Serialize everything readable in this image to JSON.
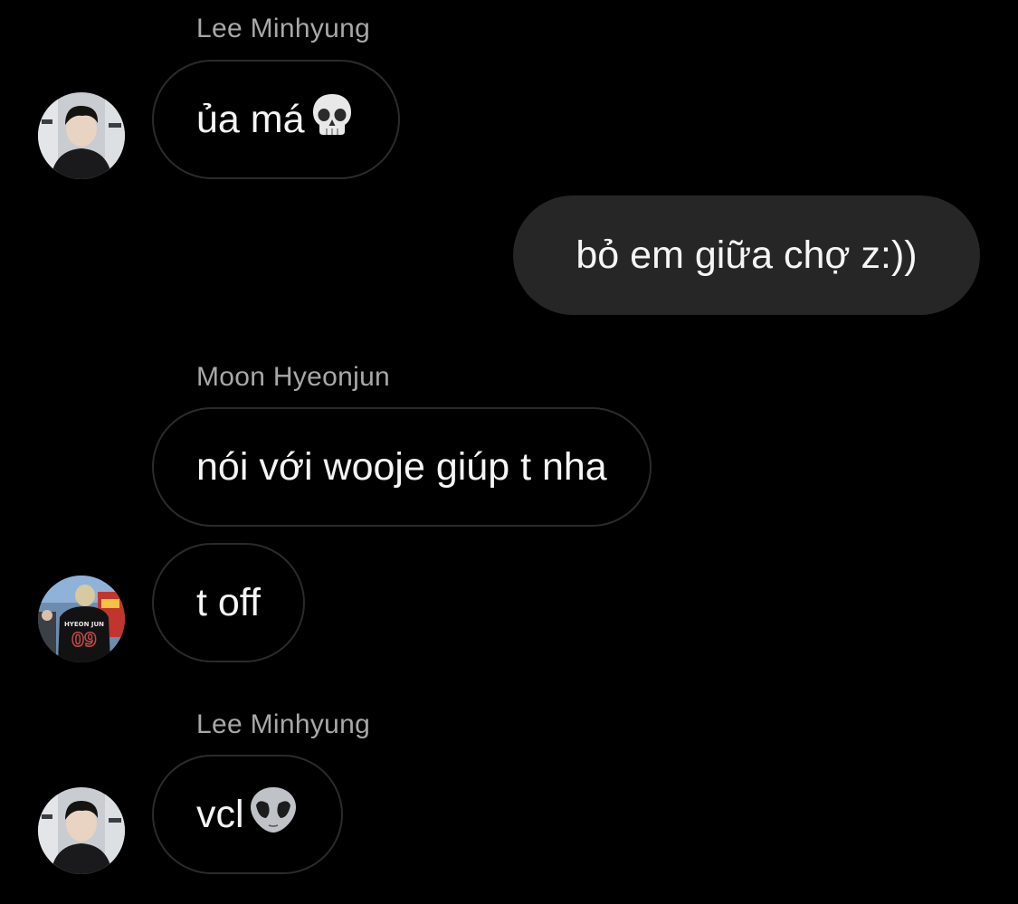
{
  "messages": [
    {
      "sender": "Lee Minhyung",
      "text": "ủa má",
      "emoji": "skull-icon"
    },
    {
      "text": "bỏ em giữa chợ z:))"
    },
    {
      "sender": "Moon Hyeonjun",
      "text": "nói với wooje giúp t nha"
    },
    {
      "text": "t off",
      "jersey_name": "HYEON JUN",
      "jersey_number": "09"
    },
    {
      "sender": "Lee Minhyung",
      "text": "vcl",
      "emoji": "alien-icon"
    }
  ],
  "colors": {
    "background": "#000000",
    "outgoing_bubble": "#262626",
    "incoming_border": "#2b2b2b",
    "sender_name": "#a8a8a8"
  }
}
